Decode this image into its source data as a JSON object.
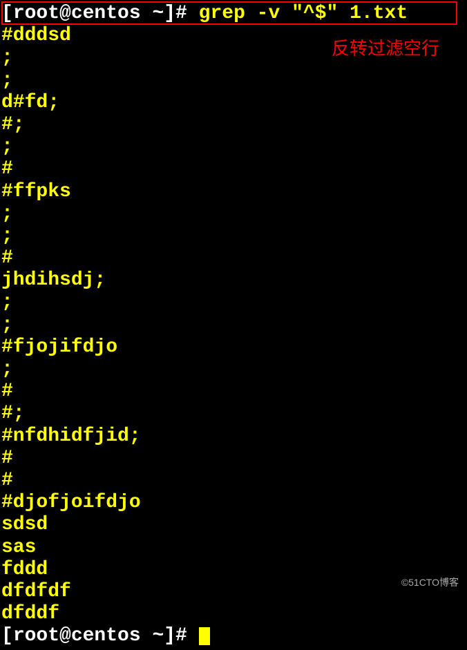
{
  "prompt1": {
    "open": "[",
    "userhost": "root@centos ~",
    "close": "]# ",
    "command": "grep -v \"^$\" 1.txt"
  },
  "output": [
    "#dddsd",
    ";",
    ";",
    "d#fd;",
    "#;",
    ";",
    "#",
    "#ffpks",
    ";",
    ";",
    "#",
    "jhdihsdj;",
    ";",
    ";",
    "#fjojifdjo",
    ";",
    "#",
    "#;",
    "#nfdhidfjid;",
    "#",
    "#",
    "#djofjoifdjo",
    "sdsd",
    "sas",
    "fddd",
    "dfdfdf",
    "dfddf"
  ],
  "prompt2": {
    "open": "[",
    "userhost": "root@centos ~",
    "close": "]# "
  },
  "annotation": "反转过滤空行",
  "watermark": "©51CTO博客"
}
